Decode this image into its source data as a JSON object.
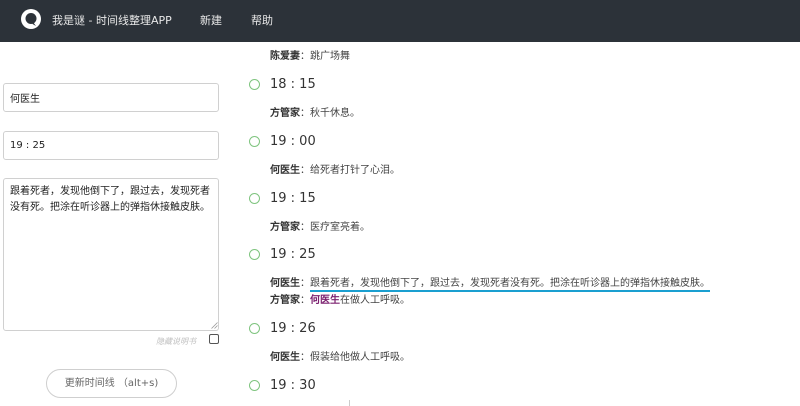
{
  "app": {
    "title": "我是谜 - 时间线整理APP",
    "nav": {
      "new_label": "新建",
      "help_label": "帮助"
    }
  },
  "editor": {
    "name_value": "何医生",
    "time_value": "19 : 25",
    "content_value": "跟着死者，发现他倒下了，跟过去，发现死者没有死。把涂在听诊器上的弹指休接触皮肤。",
    "hint_label": "隐藏说明书",
    "update_button_label": "更新时间线 （alt+s)"
  },
  "timeline": {
    "top_line": {
      "speaker": "陈爱妻",
      "sep": "：",
      "text": "跳广场舞"
    },
    "entries": [
      {
        "time": "18 : 15",
        "lines": [
          {
            "speaker": "方管家",
            "sep": "：",
            "text": "秋千休息。"
          }
        ]
      },
      {
        "time": "19 : 00",
        "lines": [
          {
            "speaker": "何医生",
            "sep": "：",
            "text": "给死者打针了心泪。"
          }
        ]
      },
      {
        "time": "19 : 15",
        "lines": [
          {
            "speaker": "方管家",
            "sep": "：",
            "text": "医疗室亮着。"
          }
        ]
      },
      {
        "time": "19 : 25",
        "lines": [
          {
            "speaker": "何医生",
            "sep": "：",
            "text": "跟着死者，发现他倒下了，跟过去，发现死者没有死。把涂在听诊器上的弹指休接触皮肤。"
          },
          {
            "speaker": "方管家",
            "sep": "：",
            "highlight": "何医生",
            "text": "在做人工呼吸。"
          }
        ]
      },
      {
        "time": "19 : 26",
        "lines": [
          {
            "speaker": "何医生",
            "sep": "：",
            "text": "假装给他做人工呼吸。"
          }
        ]
      },
      {
        "time": "19 : 30",
        "lines": []
      }
    ]
  }
}
